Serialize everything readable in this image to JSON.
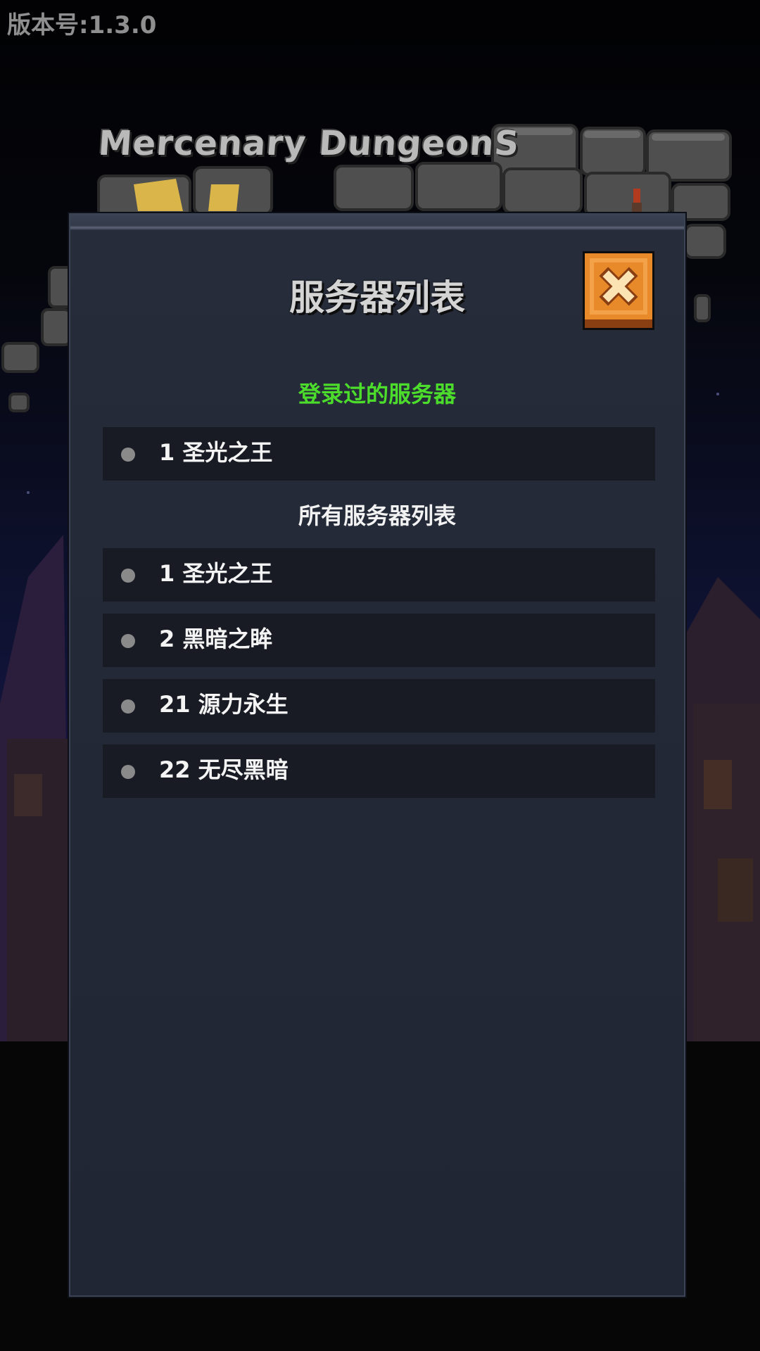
{
  "version_text": "版本号:1.3.0",
  "logo": {
    "text": "Mercenary DungeonS"
  },
  "dialog": {
    "title": "服务器列表",
    "close_icon": "close-icon",
    "recent_label": "登录过的服务器",
    "all_label": "所有服务器列表",
    "recent_servers": [
      {
        "label": "1 圣光之王"
      }
    ],
    "all_servers": [
      {
        "label": "1 圣光之王"
      },
      {
        "label": "2 黑暗之眸"
      },
      {
        "label": "21 源力永生"
      },
      {
        "label": "22 无尽黑暗"
      }
    ]
  },
  "colors": {
    "recent_label": "#4cdc2c",
    "panel": "#232937",
    "row": "#181b24",
    "close_button": "#e88a2a"
  }
}
